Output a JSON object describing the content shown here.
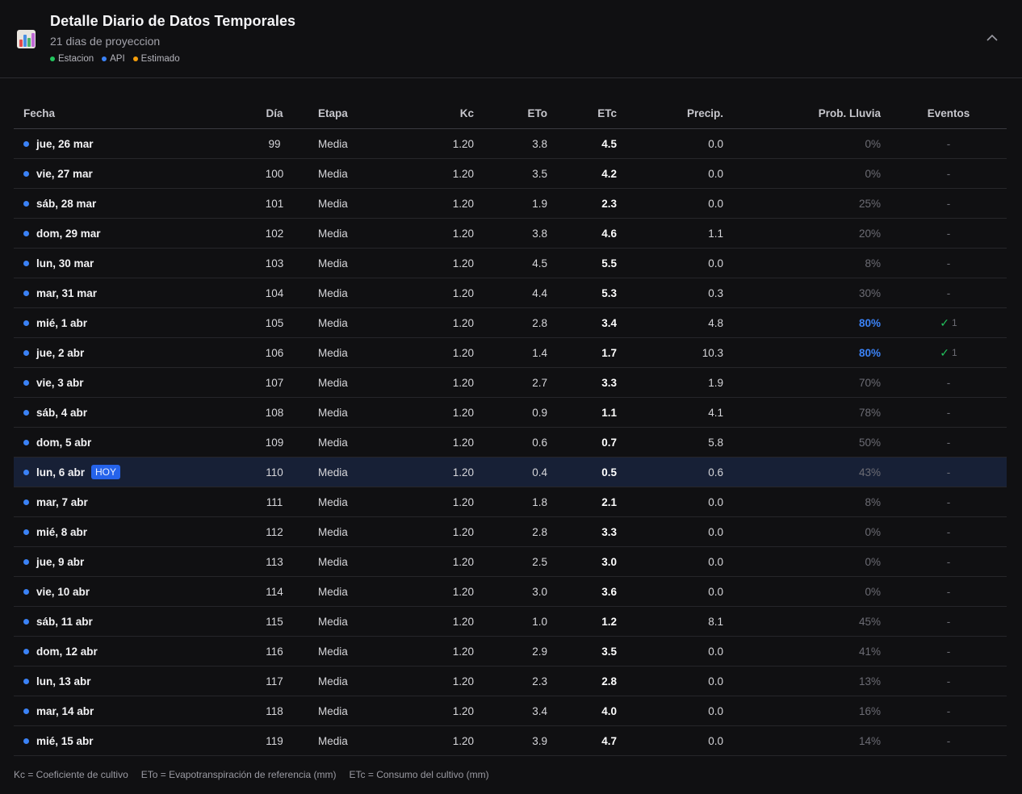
{
  "header": {
    "title": "Detalle Diario de Datos Temporales",
    "subtitle": "21 dias de proyeccion",
    "legend": [
      {
        "label": "Estacion",
        "color": "#22c55e"
      },
      {
        "label": "API",
        "color": "#3b82f6"
      },
      {
        "label": "Estimado",
        "color": "#f59e0b"
      }
    ]
  },
  "table": {
    "columns": {
      "fecha": "Fecha",
      "dia": "Día",
      "etapa": "Etapa",
      "kc": "Kc",
      "eto": "ETo",
      "etc": "ETc",
      "precip": "Precip.",
      "prob": "Prob. Lluvia",
      "eventos": "Eventos"
    },
    "today_badge": "HOY",
    "rows": [
      {
        "fecha": "jue, 26 mar",
        "dia": "99",
        "etapa": "Media",
        "kc": "1.20",
        "eto": "3.8",
        "etc": "4.5",
        "precip": "0.0",
        "prob": "0%",
        "eventos": "-"
      },
      {
        "fecha": "vie, 27 mar",
        "dia": "100",
        "etapa": "Media",
        "kc": "1.20",
        "eto": "3.5",
        "etc": "4.2",
        "precip": "0.0",
        "prob": "0%",
        "eventos": "-"
      },
      {
        "fecha": "sáb, 28 mar",
        "dia": "101",
        "etapa": "Media",
        "kc": "1.20",
        "eto": "1.9",
        "etc": "2.3",
        "precip": "0.0",
        "prob": "25%",
        "eventos": "-"
      },
      {
        "fecha": "dom, 29 mar",
        "dia": "102",
        "etapa": "Media",
        "kc": "1.20",
        "eto": "3.8",
        "etc": "4.6",
        "precip": "1.1",
        "prob": "20%",
        "eventos": "-"
      },
      {
        "fecha": "lun, 30 mar",
        "dia": "103",
        "etapa": "Media",
        "kc": "1.20",
        "eto": "4.5",
        "etc": "5.5",
        "precip": "0.0",
        "prob": "8%",
        "eventos": "-"
      },
      {
        "fecha": "mar, 31 mar",
        "dia": "104",
        "etapa": "Media",
        "kc": "1.20",
        "eto": "4.4",
        "etc": "5.3",
        "precip": "0.3",
        "prob": "30%",
        "eventos": "-"
      },
      {
        "fecha": "mié, 1 abr",
        "dia": "105",
        "etapa": "Media",
        "kc": "1.20",
        "eto": "2.8",
        "etc": "3.4",
        "precip": "4.8",
        "prob": "80%",
        "eventos": "✓",
        "eventos_count": "1",
        "prob_high": true
      },
      {
        "fecha": "jue, 2 abr",
        "dia": "106",
        "etapa": "Media",
        "kc": "1.20",
        "eto": "1.4",
        "etc": "1.7",
        "precip": "10.3",
        "prob": "80%",
        "eventos": "✓",
        "eventos_count": "1",
        "prob_high": true
      },
      {
        "fecha": "vie, 3 abr",
        "dia": "107",
        "etapa": "Media",
        "kc": "1.20",
        "eto": "2.7",
        "etc": "3.3",
        "precip": "1.9",
        "prob": "70%",
        "eventos": "-"
      },
      {
        "fecha": "sáb, 4 abr",
        "dia": "108",
        "etapa": "Media",
        "kc": "1.20",
        "eto": "0.9",
        "etc": "1.1",
        "precip": "4.1",
        "prob": "78%",
        "eventos": "-"
      },
      {
        "fecha": "dom, 5 abr",
        "dia": "109",
        "etapa": "Media",
        "kc": "1.20",
        "eto": "0.6",
        "etc": "0.7",
        "precip": "5.8",
        "prob": "50%",
        "eventos": "-"
      },
      {
        "fecha": "lun, 6 abr",
        "dia": "110",
        "etapa": "Media",
        "kc": "1.20",
        "eto": "0.4",
        "etc": "0.5",
        "precip": "0.6",
        "prob": "43%",
        "eventos": "-",
        "today": true
      },
      {
        "fecha": "mar, 7 abr",
        "dia": "111",
        "etapa": "Media",
        "kc": "1.20",
        "eto": "1.8",
        "etc": "2.1",
        "precip": "0.0",
        "prob": "8%",
        "eventos": "-"
      },
      {
        "fecha": "mié, 8 abr",
        "dia": "112",
        "etapa": "Media",
        "kc": "1.20",
        "eto": "2.8",
        "etc": "3.3",
        "precip": "0.0",
        "prob": "0%",
        "eventos": "-"
      },
      {
        "fecha": "jue, 9 abr",
        "dia": "113",
        "etapa": "Media",
        "kc": "1.20",
        "eto": "2.5",
        "etc": "3.0",
        "precip": "0.0",
        "prob": "0%",
        "eventos": "-"
      },
      {
        "fecha": "vie, 10 abr",
        "dia": "114",
        "etapa": "Media",
        "kc": "1.20",
        "eto": "3.0",
        "etc": "3.6",
        "precip": "0.0",
        "prob": "0%",
        "eventos": "-"
      },
      {
        "fecha": "sáb, 11 abr",
        "dia": "115",
        "etapa": "Media",
        "kc": "1.20",
        "eto": "1.0",
        "etc": "1.2",
        "precip": "8.1",
        "prob": "45%",
        "eventos": "-"
      },
      {
        "fecha": "dom, 12 abr",
        "dia": "116",
        "etapa": "Media",
        "kc": "1.20",
        "eto": "2.9",
        "etc": "3.5",
        "precip": "0.0",
        "prob": "41%",
        "eventos": "-"
      },
      {
        "fecha": "lun, 13 abr",
        "dia": "117",
        "etapa": "Media",
        "kc": "1.20",
        "eto": "2.3",
        "etc": "2.8",
        "precip": "0.0",
        "prob": "13%",
        "eventos": "-"
      },
      {
        "fecha": "mar, 14 abr",
        "dia": "118",
        "etapa": "Media",
        "kc": "1.20",
        "eto": "3.4",
        "etc": "4.0",
        "precip": "0.0",
        "prob": "16%",
        "eventos": "-"
      },
      {
        "fecha": "mié, 15 abr",
        "dia": "119",
        "etapa": "Media",
        "kc": "1.20",
        "eto": "3.9",
        "etc": "4.7",
        "precip": "0.0",
        "prob": "14%",
        "eventos": "-"
      }
    ]
  },
  "footnote": [
    "Kc = Coeficiente de cultivo",
    "ETo = Evapotranspiración de referencia (mm)",
    "ETc = Consumo del cultivo (mm)"
  ],
  "colors": {
    "source_dot": "#3b82f6",
    "today_bg": "#172036",
    "check": "#22c55e"
  },
  "icons": {
    "app": "bar-chart-icon",
    "collapse": "chevron-up-icon"
  }
}
